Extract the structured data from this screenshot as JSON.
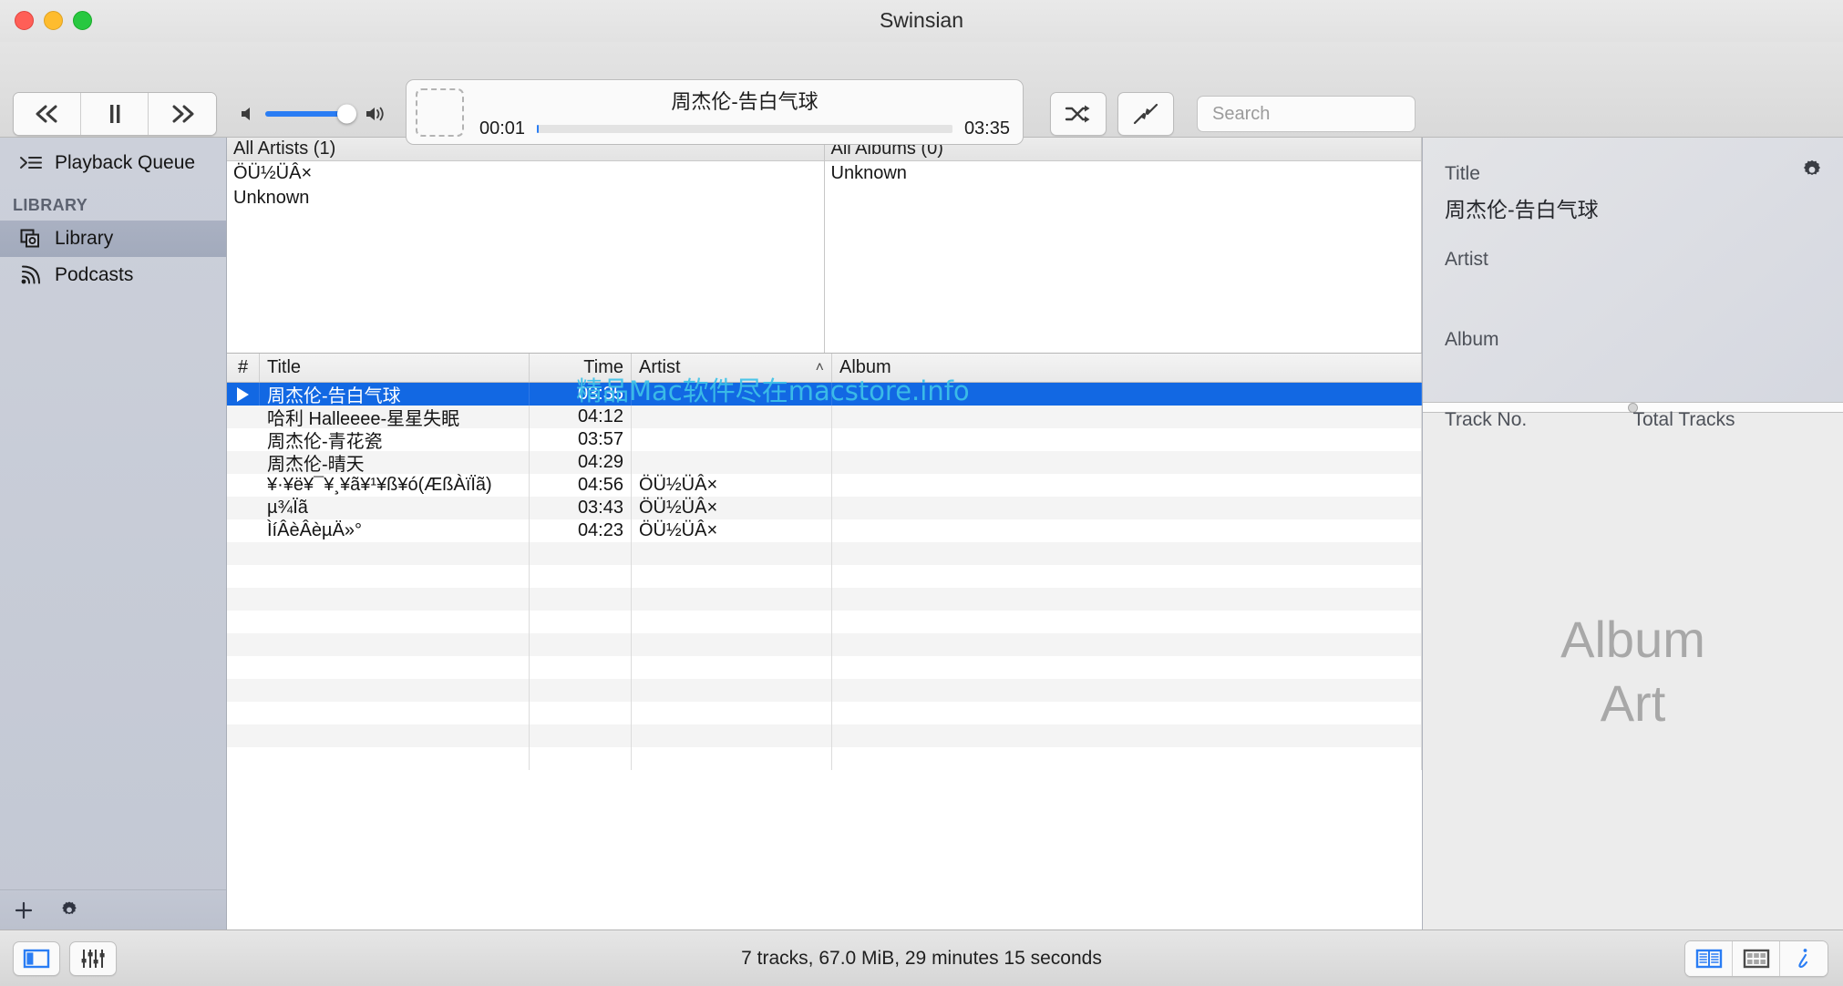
{
  "window": {
    "title": "Swinsian",
    "traffic_lights": [
      "close",
      "minimize",
      "zoom"
    ]
  },
  "toolbar": {
    "previous_label": "«",
    "pause_label": "II",
    "next_label": "»",
    "volume_percent": 88,
    "shuffle_icon": "shuffle-icon",
    "jump_to_current_icon": "jump-to-current-icon",
    "search": {
      "placeholder": "Search",
      "value": "",
      "icon": "search-icon"
    }
  },
  "now_playing": {
    "title": "周杰伦-告白气球",
    "elapsed": "00:01",
    "duration": "03:35",
    "progress_percent": 0.5,
    "artwork_placeholder": true
  },
  "sidebar": {
    "queue": {
      "label": "Playback Queue",
      "icon": "playback-queue-icon"
    },
    "section_header": "LIBRARY",
    "items": [
      {
        "label": "Library",
        "icon": "library-icon",
        "selected": true
      },
      {
        "label": "Podcasts",
        "icon": "podcasts-icon",
        "selected": false
      }
    ],
    "footer": {
      "add_icon": "plus-icon",
      "settings_icon": "gear-icon"
    }
  },
  "browsers": {
    "artists": {
      "header": "All Artists (1)",
      "rows": [
        "ÖÜ½ÜÂ×",
        "Unknown"
      ]
    },
    "albums": {
      "header": "All Albums (0)",
      "rows": [
        "Unknown"
      ]
    }
  },
  "tracks": {
    "columns": [
      {
        "key": "num",
        "label": "#",
        "sorted": false
      },
      {
        "key": "title",
        "label": "Title",
        "sorted": false
      },
      {
        "key": "time",
        "label": "Time",
        "sorted": false
      },
      {
        "key": "artist",
        "label": "Artist",
        "sorted": true,
        "sort_caret": "˄"
      },
      {
        "key": "album",
        "label": "Album",
        "sorted": false
      }
    ],
    "rows": [
      {
        "num": "▶",
        "title": "周杰伦-告白气球",
        "time": "03:35",
        "artist": "",
        "album": "",
        "selected": true,
        "playing": true
      },
      {
        "num": "",
        "title": "哈利 Halleeee-星星失眠",
        "time": "04:12",
        "artist": "",
        "album": "",
        "selected": false,
        "playing": false
      },
      {
        "num": "",
        "title": "周杰伦-青花瓷",
        "time": "03:57",
        "artist": "",
        "album": "",
        "selected": false,
        "playing": false
      },
      {
        "num": "",
        "title": "周杰伦-晴天",
        "time": "04:29",
        "artist": "",
        "album": "",
        "selected": false,
        "playing": false
      },
      {
        "num": "",
        "title": "¥·¥ë¥¯¥¸¥ã¥¹¥ß¥ó(ÆßÀïÏã)",
        "time": "04:56",
        "artist": "ÖÜ½ÜÂ×",
        "album": "",
        "selected": false,
        "playing": false
      },
      {
        "num": "",
        "title": "µ¾Ïã",
        "time": "03:43",
        "artist": "ÖÜ½ÜÂ×",
        "album": "",
        "selected": false,
        "playing": false
      },
      {
        "num": "",
        "title": "ÌíÂèÂèµÄ»°",
        "time": "04:23",
        "artist": "ÖÜ½ÜÂ×",
        "album": "",
        "selected": false,
        "playing": false
      }
    ],
    "empty_row_count": 9
  },
  "watermark": {
    "text": "精品Mac软件尽在macstore.info",
    "color": "#3ec2e8"
  },
  "inspector": {
    "gear_icon": "gear-icon",
    "fields": [
      {
        "label": "Title",
        "value": "周杰伦-告白气球"
      },
      {
        "label": "Artist",
        "value": ""
      },
      {
        "label": "Album",
        "value": ""
      }
    ],
    "track_no_label": "Track No.",
    "track_no_value": "",
    "total_tracks_label": "Total Tracks",
    "total_tracks_value": "",
    "album_art_line1": "Album",
    "album_art_line2": "Art"
  },
  "statusbar": {
    "sidebar_toggle_icon": "sidebar-toggle-icon",
    "equalizer_icon": "equalizer-icon",
    "summary": "7 tracks,  67.0 MiB,  29 minutes 15 seconds",
    "list_view_icon": "list-view-icon",
    "grid_view_icon": "grid-view-icon",
    "info_icon": "info-icon"
  },
  "colors": {
    "accent_blue": "#1268e3",
    "slider_blue": "#2a7df4",
    "selection_sidebar": "#a2aabc"
  }
}
